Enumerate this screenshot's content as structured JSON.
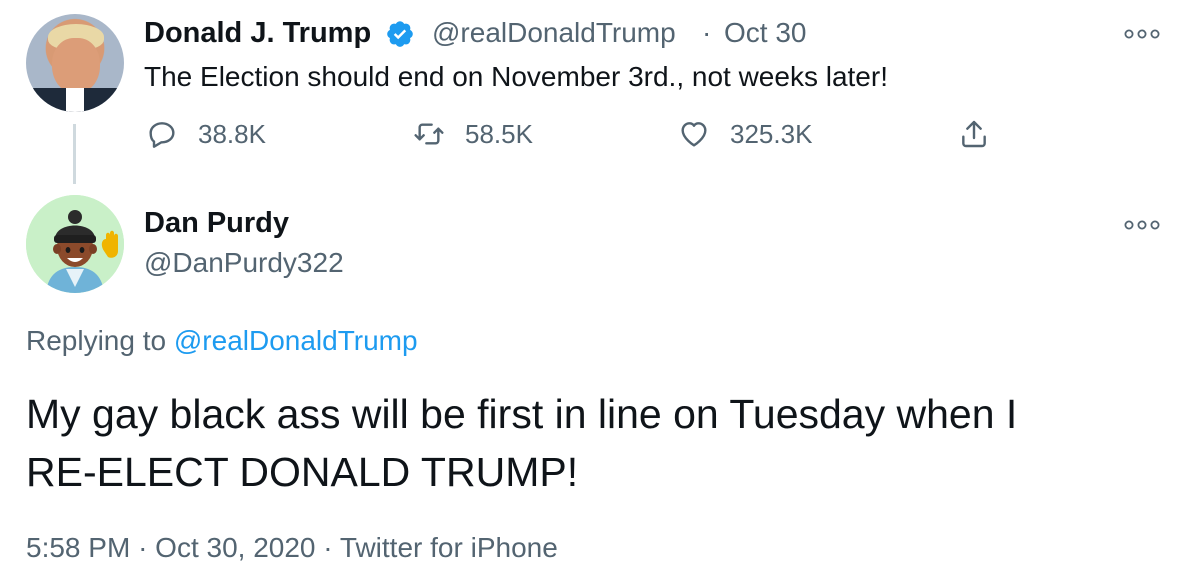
{
  "parent_tweet": {
    "author_name": "Donald J. Trump",
    "handle": "@realDonaldTrump",
    "separator": "·",
    "date": "Oct 30",
    "text": "The Election should end on November 3rd., not weeks later!",
    "avatar_icon": "user-avatar-photo",
    "verified_icon": "verified-badge-icon",
    "more_icon": "more-options-icon",
    "actions": {
      "reply_count": "38.8K",
      "retweet_count": "58.5K",
      "like_count": "325.3K"
    }
  },
  "reply_tweet": {
    "author_name": "Dan Purdy",
    "handle": "@DanPurdy322",
    "avatar_icon": "memoji-avatar",
    "more_icon": "more-options-icon",
    "replying_to_label": "Replying to",
    "replying_to_handle": "@realDonaldTrump",
    "text_line1": "My gay black ass will be first in line on Tuesday when I",
    "text_line2": "RE-ELECT DONALD TRUMP!",
    "time": "5:58 PM",
    "date": "Oct 30, 2020",
    "source": "Twitter for iPhone",
    "separator": "·"
  },
  "colors": {
    "text_primary": "#0f1419",
    "text_secondary": "#536471",
    "link": "#1d9bf0",
    "verified": "#1d9bf0",
    "thread_line": "#cfd9de"
  }
}
